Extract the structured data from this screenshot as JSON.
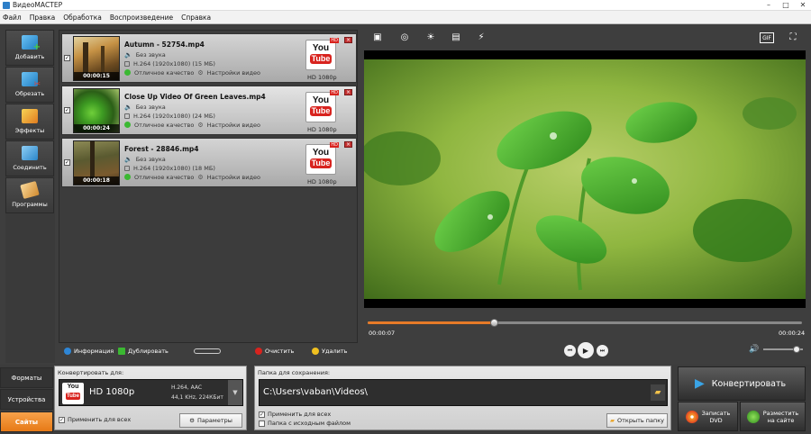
{
  "window": {
    "title": "ВидеоМАСТЕР"
  },
  "menu": [
    "Файл",
    "Правка",
    "Обработка",
    "Воспроизведение",
    "Справка"
  ],
  "sidebar": [
    {
      "label": "Добавить",
      "icon": "add-film-icon",
      "color": "#3aa4e6"
    },
    {
      "label": "Обрезать",
      "icon": "cut-icon",
      "color": "#e0463c"
    },
    {
      "label": "Эффекты",
      "icon": "effects-icon",
      "color": "#f1b52a"
    },
    {
      "label": "Соединить",
      "icon": "join-icon",
      "color": "#59a8dd"
    },
    {
      "label": "Программы",
      "icon": "programs-icon",
      "color": "#e9a84a"
    }
  ],
  "files": [
    {
      "name": "Autumn - 52754.mp4",
      "audio": "Без звука",
      "codec": "H.264 (1920x1080) (15 МБ)",
      "quality": "Отличное качество",
      "settings": "Настройки видео",
      "duration": "00:00:15",
      "format": "HD 1080p",
      "checked": true
    },
    {
      "name": "Close Up Video Of Green Leaves.mp4",
      "audio": "Без звука",
      "codec": "H.264 (1920x1080) (24 МБ)",
      "quality": "Отличное качество",
      "settings": "Настройки видео",
      "duration": "00:00:24",
      "format": "HD 1080p",
      "checked": true
    },
    {
      "name": "Forest - 28846.mp4",
      "audio": "Без звука",
      "codec": "H.264 (1920x1080) (18 МБ)",
      "quality": "Отличное качество",
      "settings": "Настройки видео",
      "duration": "00:00:18",
      "format": "HD 1080p",
      "checked": true
    }
  ],
  "youtube": {
    "you": "You",
    "tube": "Tube",
    "hd": "HD"
  },
  "filetools": {
    "info": "Информация",
    "duplicate": "Дублировать",
    "clear": "Очистить",
    "delete": "Удалить"
  },
  "player": {
    "current": "00:00:07",
    "total": "00:00:24",
    "progress": 0.29,
    "volume": 0.85
  },
  "left_tabs": [
    {
      "label": "Форматы",
      "active": false
    },
    {
      "label": "Устройства",
      "active": false
    },
    {
      "label": "Сайты",
      "active": true
    }
  ],
  "convert_for": {
    "label": "Конвертировать для:",
    "format": "HD 1080p",
    "codec_line1": "H.264, AAC",
    "codec_line2": "44,1 KHz, 224КБит",
    "apply_all": "Применить для всех",
    "params": "Параметры"
  },
  "save_folder": {
    "label": "Папка для сохранения:",
    "path": "C:\\Users\\vaban\\Videos\\",
    "apply_all": "Применить для всех",
    "source_folder": "Папка с исходным файлом",
    "open": "Открыть папку"
  },
  "actions": {
    "convert": "Конвертировать",
    "dvd_line1": "Записать",
    "dvd_line2": "DVD",
    "web_line1": "Разместить",
    "web_line2": "на сайте"
  },
  "colors": {
    "accent_orange": "#e77b28",
    "tab_active": "#f29a3f",
    "quality_green": "#3bb832",
    "delete_red": "#c43030",
    "youtube_red": "#d8231e"
  }
}
